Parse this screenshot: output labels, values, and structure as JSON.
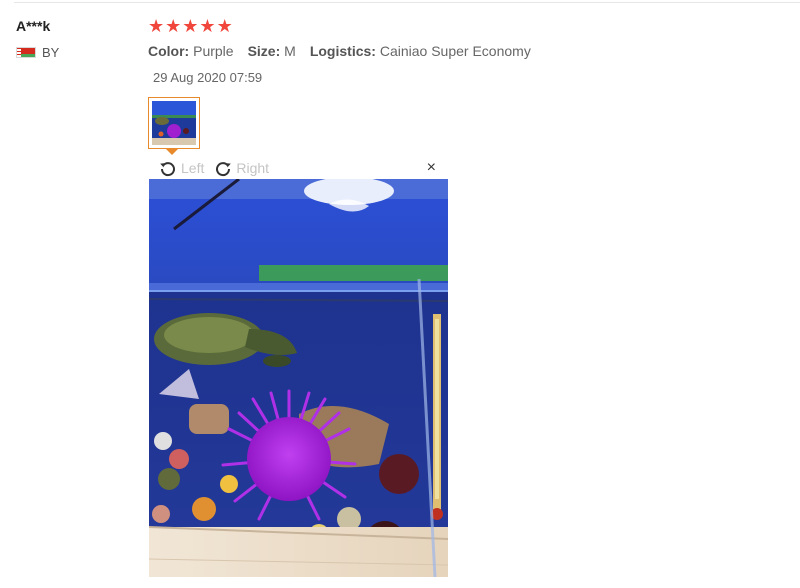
{
  "review": {
    "reviewer": "A***k",
    "country_code": "BY",
    "rating": 5,
    "attributes": [
      {
        "key": "Color:",
        "value": "Purple"
      },
      {
        "key": "Size:",
        "value": "M"
      },
      {
        "key": "Logistics:",
        "value": "Cainiao Super Economy"
      }
    ],
    "date": "29 Aug 2020 07:59"
  },
  "viewer": {
    "rotate_left_label": "Left",
    "rotate_right_label": "Right",
    "close_glyph": "×"
  },
  "icons": {
    "star": "star-icon",
    "rotate_left": "rotate-left-icon",
    "rotate_right": "rotate-right-icon",
    "close": "close-icon",
    "flag": "belarus-flag-icon"
  },
  "colors": {
    "star": "#f0463c",
    "thumb_border": "#e88a2b",
    "toolbar_text": "#c4c4c4"
  }
}
